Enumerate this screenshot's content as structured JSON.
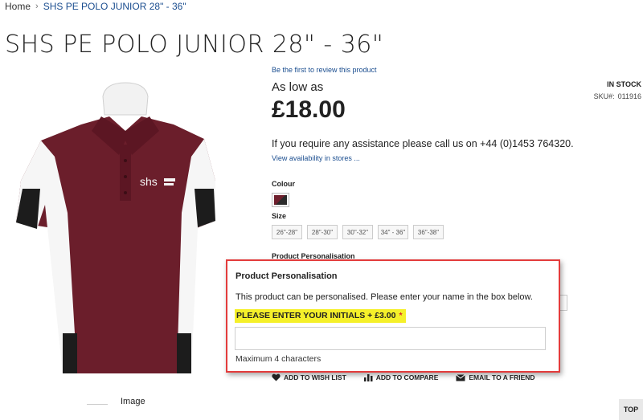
{
  "breadcrumb": {
    "home": "Home",
    "separator": "›",
    "current": "SHS PE POLO JUNIOR 28\" - 36\""
  },
  "product": {
    "title": "SHS PE POLO JUNIOR 28\" - 36\"",
    "review_link": "Be the first to review this product",
    "price_prefix": "As low as",
    "price": "£18.00",
    "stock_status": "IN STOCK",
    "sku_label": "SKU#:",
    "sku_value": "011916",
    "assistance": "If you require any assistance please call us on +44 (0)1453 764320.",
    "availability_link": "View availability in stores ...",
    "image_label": "Image",
    "shirt_logo": "shs"
  },
  "options": {
    "colour_label": "Colour",
    "size_label": "Size",
    "sizes": [
      "26\"-28\"",
      "28\"-30\"",
      "30\"-32\"",
      "34\" - 36\"",
      "36\"-38\""
    ],
    "personalisation_label": "Product Personalisation"
  },
  "popup": {
    "title": "Product Personalisation",
    "description": "This product can be personalised.  Please enter your name in the box below.",
    "initials_label": "PLEASE ENTER YOUR INITIALS + £3.00",
    "required_mark": "*",
    "input_value": "",
    "hint": "Maximum 4 characters"
  },
  "actions": {
    "wishlist": "ADD TO WISH LIST",
    "compare": "ADD TO COMPARE",
    "email": "EMAIL TO A FRIEND",
    "top": "TOP"
  },
  "colors": {
    "link": "#1a4d8f",
    "popup_border": "#e33c3c",
    "highlight": "#f5f02a",
    "shirt_maroon": "#6b1e2b"
  }
}
